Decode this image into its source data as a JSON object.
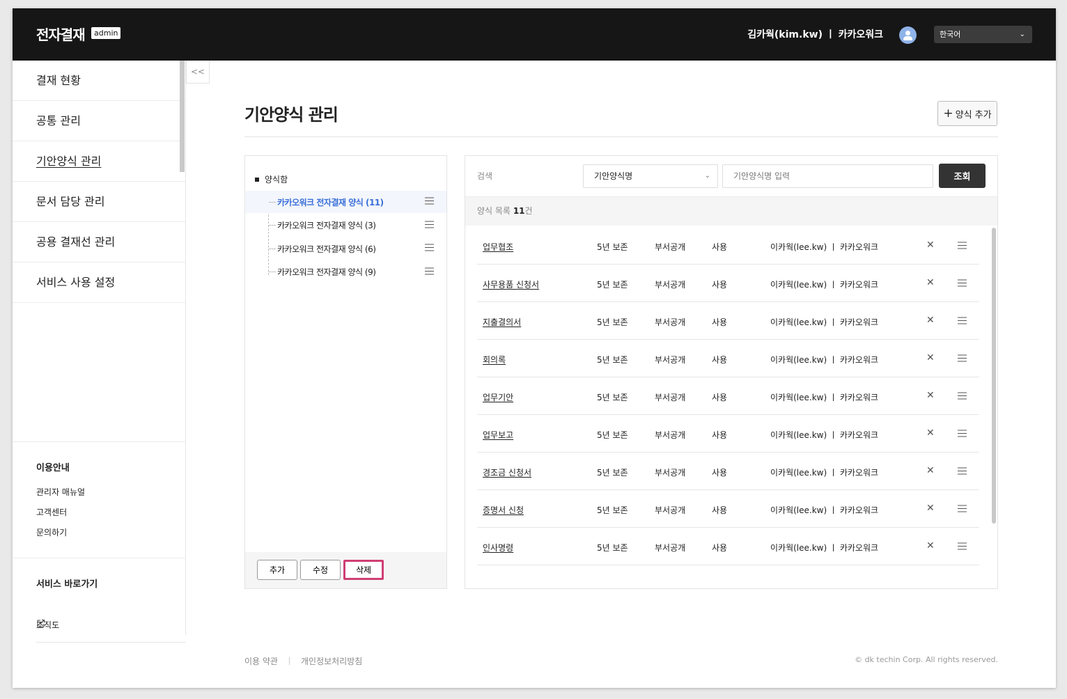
{
  "header": {
    "brand": "전자결재",
    "badge": "admin",
    "user": "김카웍(kim.kw) ㅣ 카카오워크",
    "language": "한국어"
  },
  "sidebar": {
    "items": [
      {
        "label": "결재 현황"
      },
      {
        "label": "공통 관리"
      },
      {
        "label": "기안양식 관리"
      },
      {
        "label": "문서 담당 관리"
      },
      {
        "label": "공용 결재선 관리"
      },
      {
        "label": "서비스 사용 설정"
      }
    ],
    "active_item": "기안양식 관리",
    "info_title": "이용안내",
    "info_links": [
      "관리자 매뉴얼",
      "고객센터",
      "문의하기"
    ],
    "shortcut_title": "서비스 바로가기",
    "shortcut_link": "조직도",
    "collapse_label": "<<"
  },
  "page": {
    "title": "기안양식 관리",
    "add_button": "양식 추가"
  },
  "tree": {
    "root": "양식함",
    "items": [
      {
        "label": "카카오워크 전자결재 양식 (11)",
        "selected": true
      },
      {
        "label": "카카오워크 전자결재 양식 (3)",
        "selected": false
      },
      {
        "label": "카카오워크 전자결재 양식 (6)",
        "selected": false
      },
      {
        "label": "카카오워크 전자결재 양식 (9)",
        "selected": false
      }
    ],
    "buttons": {
      "add": "추가",
      "edit": "수정",
      "delete": "삭제"
    }
  },
  "search": {
    "label": "검색",
    "field": "기안양식명",
    "placeholder": "기안양식명 입력",
    "button": "조회"
  },
  "list": {
    "header_prefix": "양식 목록",
    "count": "11",
    "count_suffix": "건",
    "rows": [
      {
        "name": "업무협조",
        "retention": "5년 보존",
        "visibility": "부서공개",
        "status": "사용",
        "owner": "이카웍(lee.kw) ㅣ 카카오워크"
      },
      {
        "name": "사무용품 신청서",
        "retention": "5년 보존",
        "visibility": "부서공개",
        "status": "사용",
        "owner": "이카웍(lee.kw) ㅣ 카카오워크"
      },
      {
        "name": "지출결의서",
        "retention": "5년 보존",
        "visibility": "부서공개",
        "status": "사용",
        "owner": "이카웍(lee.kw) ㅣ 카카오워크"
      },
      {
        "name": "회의록",
        "retention": "5년 보존",
        "visibility": "부서공개",
        "status": "사용",
        "owner": "이카웍(lee.kw) ㅣ 카카오워크"
      },
      {
        "name": "업무기안",
        "retention": "5년 보존",
        "visibility": "부서공개",
        "status": "사용",
        "owner": "이카웍(lee.kw) ㅣ 카카오워크"
      },
      {
        "name": "업무보고",
        "retention": "5년 보존",
        "visibility": "부서공개",
        "status": "사용",
        "owner": "이카웍(lee.kw) ㅣ 카카오워크"
      },
      {
        "name": "경조금 신청서",
        "retention": "5년 보존",
        "visibility": "부서공개",
        "status": "사용",
        "owner": "이카웍(lee.kw) ㅣ 카카오워크"
      },
      {
        "name": "증명서 신청",
        "retention": "5년 보존",
        "visibility": "부서공개",
        "status": "사용",
        "owner": "이카웍(lee.kw) ㅣ 카카오워크"
      },
      {
        "name": "인사명령",
        "retention": "5년 보존",
        "visibility": "부서공개",
        "status": "사용",
        "owner": "이카웍(lee.kw) ㅣ 카카오워크"
      }
    ]
  },
  "footer": {
    "terms": "이용 약관",
    "privacy": "개인정보처리방침",
    "copyright": "© dk techin Corp. All rights reserved."
  },
  "colors": {
    "header_bg": "#161616",
    "selected_text": "#3b6fd8",
    "delete_highlight": "#cf3f73",
    "search_button": "#333333"
  },
  "icons": {
    "avatar": "user-avatar-icon",
    "dropdown": "chevron-down-icon",
    "row_delete": "close-icon",
    "row_menu": "drag-menu-icon",
    "external": "external-link-icon",
    "add": "plus-icon"
  }
}
